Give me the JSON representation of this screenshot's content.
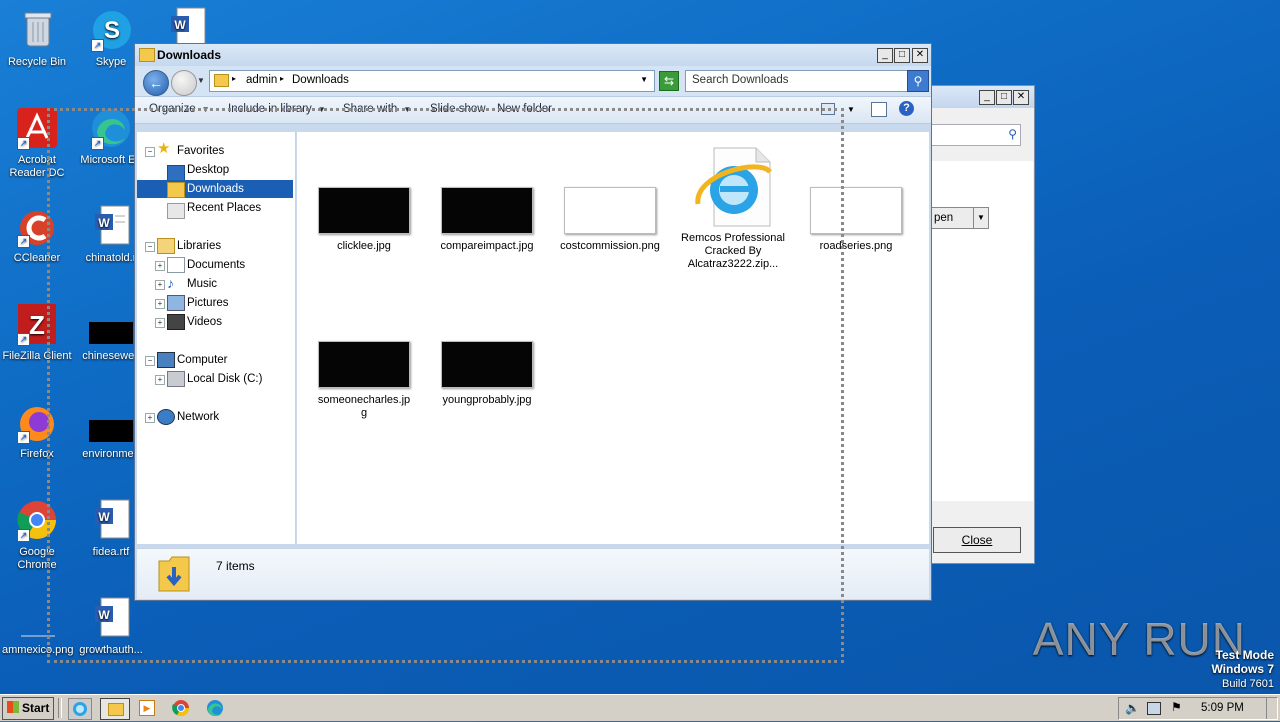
{
  "desktop": {
    "icons": [
      {
        "label": "Recycle Bin"
      },
      {
        "label": "Skype"
      },
      {
        "label": "Acrobat Reader DC"
      },
      {
        "label": "Microsoft Ed"
      },
      {
        "label": "CCleaner"
      },
      {
        "label": "chinatold.r"
      },
      {
        "label": "FileZilla Client"
      },
      {
        "label": "chinesewe.j"
      },
      {
        "label": "Firefox"
      },
      {
        "label": "environmen"
      },
      {
        "label": "Google Chrome"
      },
      {
        "label": "fidea.rtf"
      },
      {
        "label": "ammexico.png"
      },
      {
        "label": "growthauth..."
      }
    ]
  },
  "background_window": {
    "open_label": "pen",
    "close_label": "Close"
  },
  "explorer": {
    "title": "Downloads",
    "breadcrumb": [
      "admin",
      "Downloads"
    ],
    "search_placeholder": "Search Downloads",
    "toolbar": {
      "organize": "Organize",
      "include_in_library": "Include in library",
      "share_with": "Share with",
      "slide_show": "Slide show",
      "new_folder": "New folder"
    },
    "nav": {
      "favorites": "Favorites",
      "desktop": "Desktop",
      "downloads": "Downloads",
      "recent_places": "Recent Places",
      "libraries": "Libraries",
      "documents": "Documents",
      "music": "Music",
      "pictures": "Pictures",
      "videos": "Videos",
      "computer": "Computer",
      "local_disk": "Local Disk (C:)",
      "network": "Network"
    },
    "files": [
      {
        "name": "clicklee.jpg"
      },
      {
        "name": "compareimpact.jpg"
      },
      {
        "name": "costcommission.png"
      },
      {
        "name": "Remcos Professional Cracked By Alcatraz3222.zip..."
      },
      {
        "name": "roadseries.png"
      },
      {
        "name": "someonecharles.jpg"
      },
      {
        "name": "youngprobably.jpg"
      }
    ],
    "status": "7 items"
  },
  "taskbar": {
    "start_label": "Start",
    "clock": "5:09 PM"
  },
  "watermark": {
    "brand": "ANY RUN",
    "line1": "Test Mode",
    "line2": "Windows 7",
    "line3": "Build 7601"
  },
  "colors": {
    "desktop": "#0e6bc4",
    "selection": "#cce8ff",
    "title_gradient": "#c5d8ee"
  }
}
